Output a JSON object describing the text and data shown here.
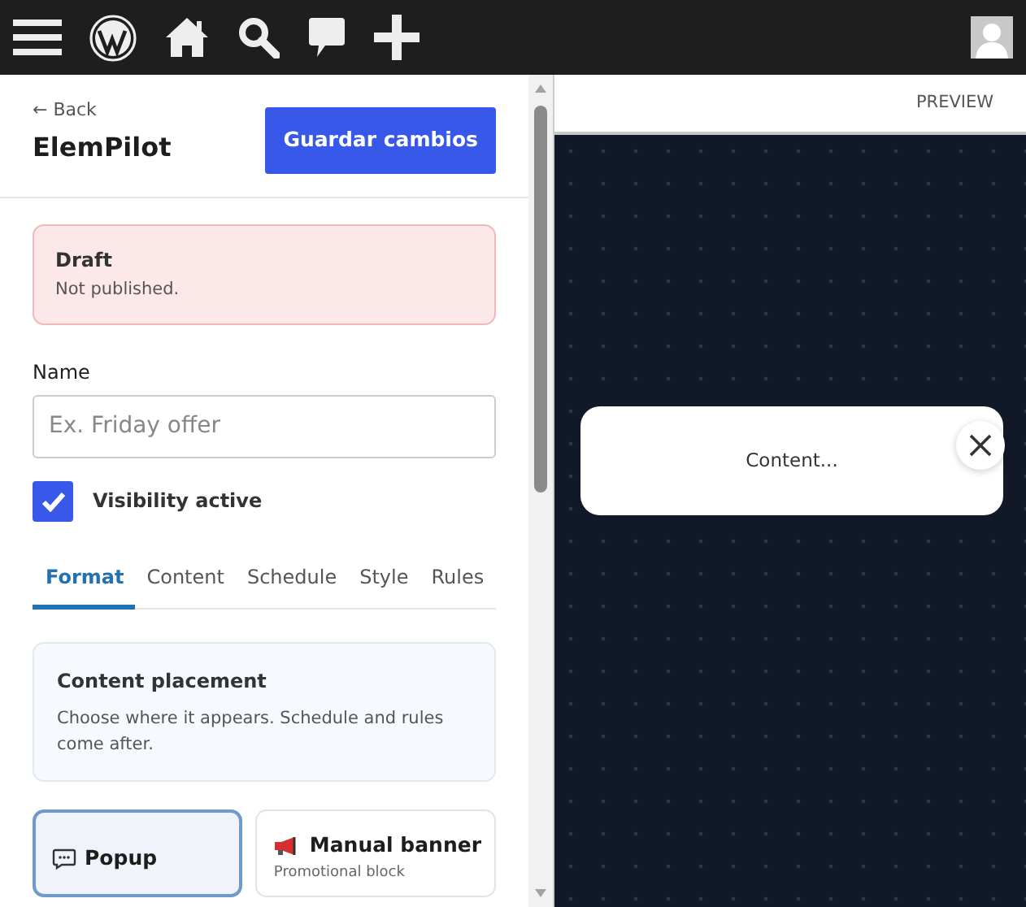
{
  "toolbar": {
    "icons": [
      {
        "kind": "menu"
      },
      {
        "kind": "wordpress"
      },
      {
        "kind": "home"
      },
      {
        "kind": "search"
      },
      {
        "kind": "comment"
      },
      {
        "kind": "plus"
      }
    ]
  },
  "editor": {
    "back_link": "← Back",
    "title": "ElemPilot",
    "save_button": "Guardar cambios",
    "status": {
      "title": "Draft",
      "text": "Not published."
    },
    "name_field": {
      "label": "Name",
      "placeholder": "Ex. Friday offer"
    },
    "visibility": {
      "label": "Visibility active",
      "checked": true
    },
    "tabs": [
      {
        "label": "Format",
        "selected": true
      },
      {
        "label": "Content",
        "selected": false
      },
      {
        "label": "Schedule",
        "selected": false
      },
      {
        "label": "Style",
        "selected": false
      },
      {
        "label": "Rules",
        "selected": false
      }
    ],
    "placement_card": {
      "title": "Content placement",
      "text": "Choose where it appears. Schedule and rules come after."
    },
    "formats": [
      {
        "kind": "popup",
        "title": "Popup",
        "selected": true
      },
      {
        "kind": "banner",
        "title": "Manual banner",
        "subtitle": "Promotional block",
        "selected": false
      }
    ]
  },
  "preview": {
    "label": "PREVIEW",
    "popup_text": "Content..."
  }
}
